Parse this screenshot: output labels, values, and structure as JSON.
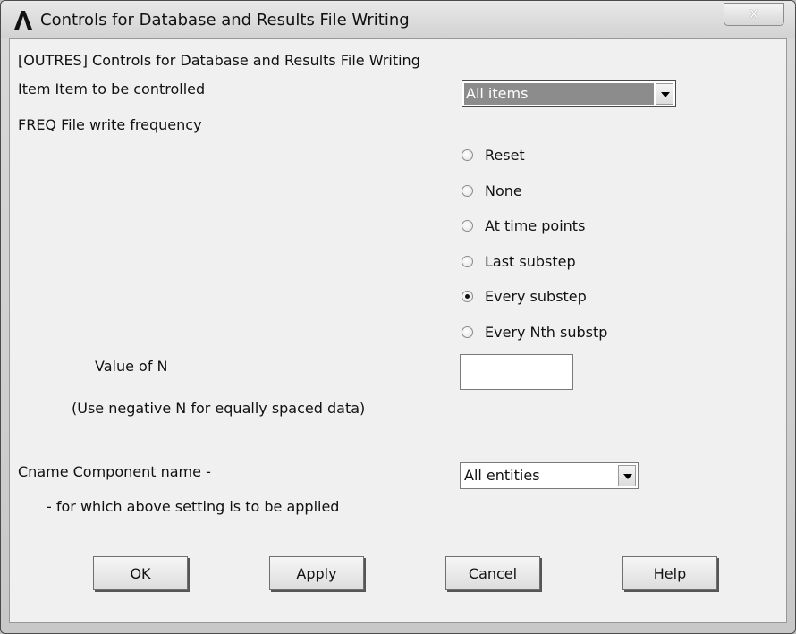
{
  "window": {
    "title": "Controls for Database and Results File Writing",
    "close_label": "x"
  },
  "form": {
    "header": "[OUTRES]  Controls for Database and Results File Writing",
    "item_label": "Item   Item to be controlled",
    "item_value": "All items",
    "freq_label": "FREQ   File write frequency",
    "freq_options": [
      {
        "label": "Reset",
        "checked": false
      },
      {
        "label": "None",
        "checked": false
      },
      {
        "label": "At time points",
        "checked": false
      },
      {
        "label": "Last substep",
        "checked": false
      },
      {
        "label": "Every substep",
        "checked": true
      },
      {
        "label": "Every Nth substp",
        "checked": false
      }
    ],
    "value_n_label": "Value of N",
    "value_n_value": "",
    "value_n_hint": "(Use negative N for equally spaced data)",
    "cname_label": "Cname  Component name -",
    "cname_value": "All entities",
    "cname_hint": "- for which above setting is to be applied"
  },
  "buttons": {
    "ok": "OK",
    "apply": "Apply",
    "cancel": "Cancel",
    "help": "Help"
  }
}
